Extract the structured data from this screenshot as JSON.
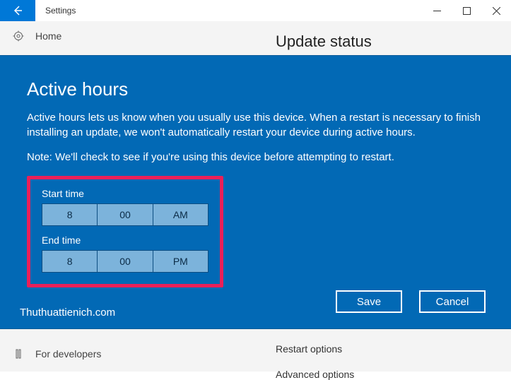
{
  "window": {
    "title": "Settings"
  },
  "page": {
    "heading": "Update status",
    "sidebar": {
      "home": "Home",
      "developers": "For developers"
    },
    "options": {
      "restart": "Restart options",
      "advanced": "Advanced options"
    }
  },
  "modal": {
    "title": "Active hours",
    "description": "Active hours lets us know when you usually use this device. When a restart is necessary to finish installing an update, we won't automatically restart your device during active hours.",
    "note": "Note: We'll check to see if you're using this device before attempting to restart.",
    "start_label": "Start time",
    "start": {
      "hour": "8",
      "minute": "00",
      "period": "AM"
    },
    "end_label": "End time",
    "end": {
      "hour": "8",
      "minute": "00",
      "period": "PM"
    },
    "save": "Save",
    "cancel": "Cancel"
  },
  "watermark": "Thuthuattienich.com"
}
